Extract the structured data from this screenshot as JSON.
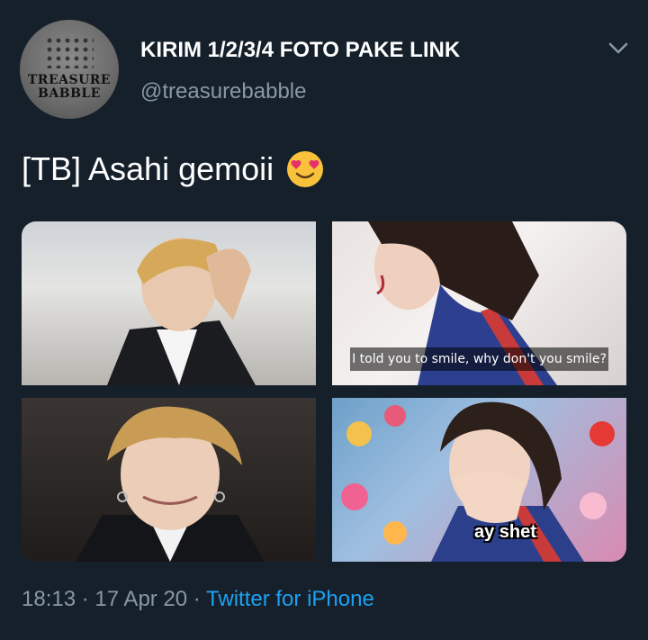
{
  "author": {
    "display_name": "KIRIM 1/2/3/4 FOTO PAKE LINK",
    "handle": "@treasurebabble",
    "avatar_text_line1": "TREASURE",
    "avatar_text_line2": "BABBLE"
  },
  "tweet": {
    "text": "[TB] Asahi gemoii",
    "emoji": "smiling-face-with-heart-eyes"
  },
  "media": {
    "photo2_caption": "I told you to smile, why don't you smile?",
    "photo4_caption": "ay shet"
  },
  "meta": {
    "time": "18:13",
    "separator": " · ",
    "date": "17 Apr 20",
    "source": "Twitter for iPhone"
  },
  "colors": {
    "background": "#15202b",
    "primary_text": "#ffffff",
    "secondary_text": "#8899a6",
    "link": "#1da1f2"
  }
}
